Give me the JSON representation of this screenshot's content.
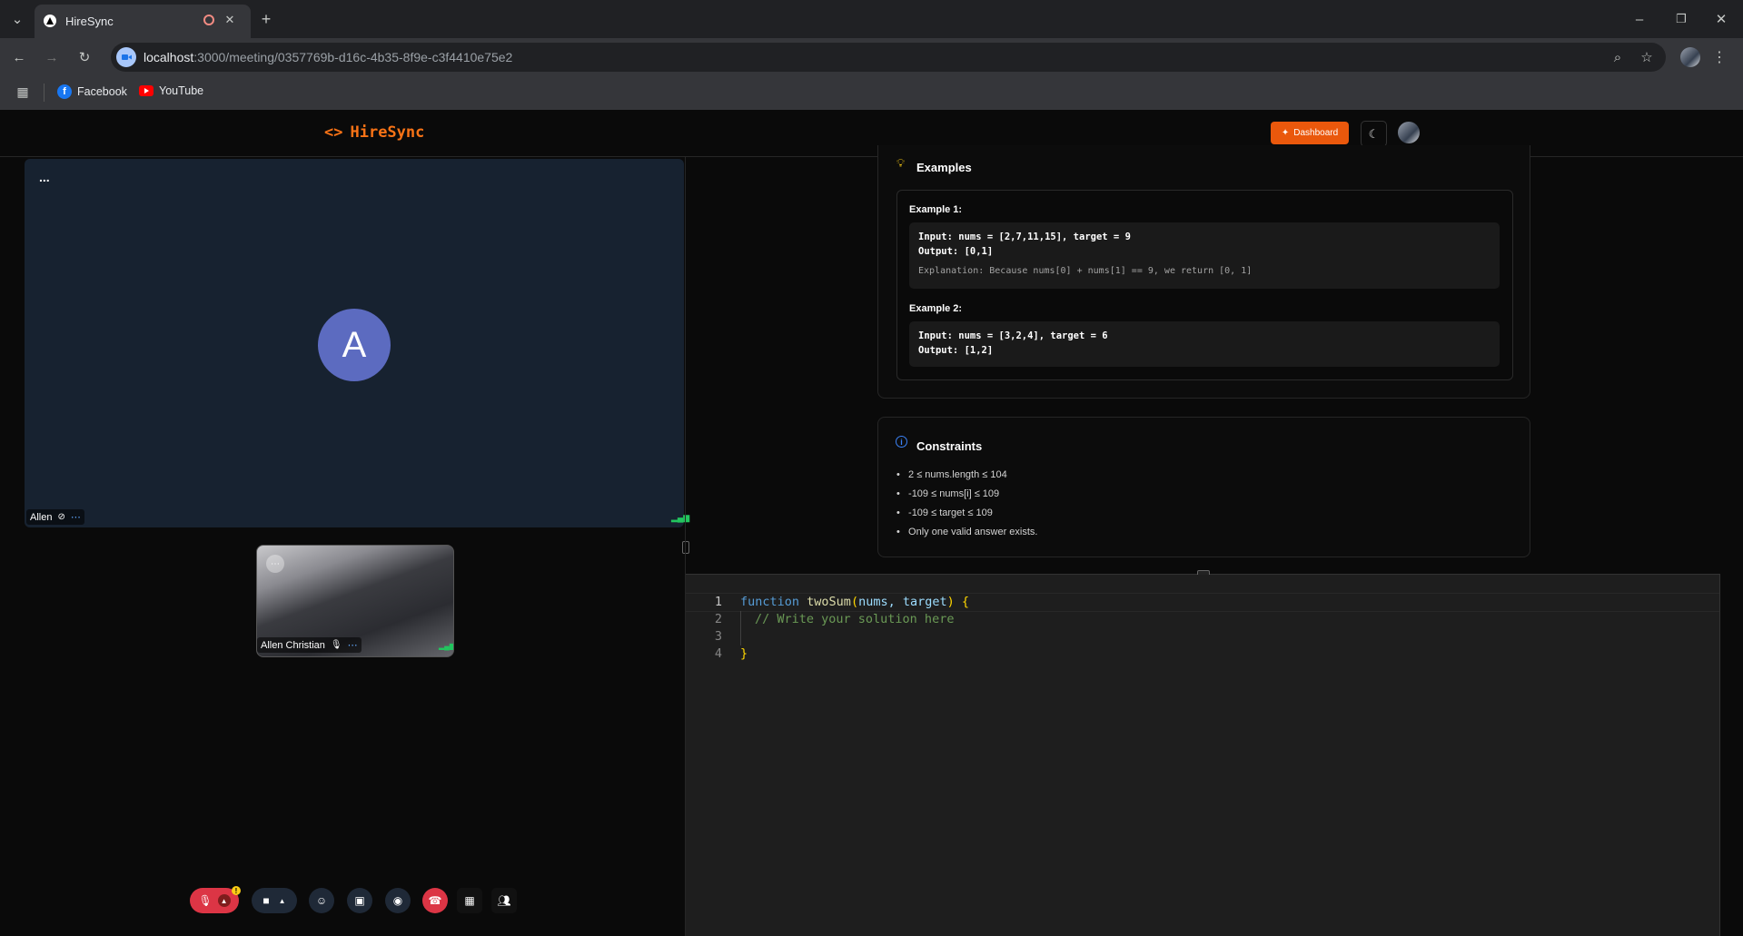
{
  "browser": {
    "tab_title": "HireSync",
    "url_host": "localhost",
    "url_rest": ":3000/meeting/0357769b-d16c-4b35-8f9e-c3f4410e75e2",
    "bookmarks": [
      {
        "label": "Facebook",
        "icon": "facebook-icon"
      },
      {
        "label": "YouTube",
        "icon": "youtube-icon"
      }
    ]
  },
  "app": {
    "brand": "HireSync",
    "dashboard_label": "Dashboard",
    "accent": "#ea580c"
  },
  "call": {
    "main_avatar_letter": "A",
    "main_name": "Allen",
    "main_menu": "...",
    "self_name": "Allen Christian",
    "mic_badge": "!"
  },
  "problem": {
    "examples_title": "Examples",
    "examples": [
      {
        "label": "Example 1:",
        "input": "Input: nums = [2,7,11,15], target = 9",
        "output": "Output: [0,1]",
        "explanation": "Explanation: Because nums[0] + nums[1] == 9, we return [0, 1]"
      },
      {
        "label": "Example 2:",
        "input": "Input: nums = [3,2,4], target = 6",
        "output": "Output: [1,2]"
      }
    ],
    "constraints_title": "Constraints",
    "constraints": [
      "2 ≤ nums.length ≤ 104",
      "-109 ≤ nums[i] ≤ 109",
      "-109 ≤ target ≤ 109",
      "Only one valid answer exists."
    ]
  },
  "editor": {
    "lines": [
      {
        "n": "1",
        "kw": "function",
        "fn": "twoSum",
        "open": "(",
        "params": "nums, target",
        "close": ")",
        "brace": "{"
      },
      {
        "n": "2",
        "comment": "// Write your solution here"
      },
      {
        "n": "3"
      },
      {
        "n": "4",
        "brace": "}"
      }
    ]
  }
}
